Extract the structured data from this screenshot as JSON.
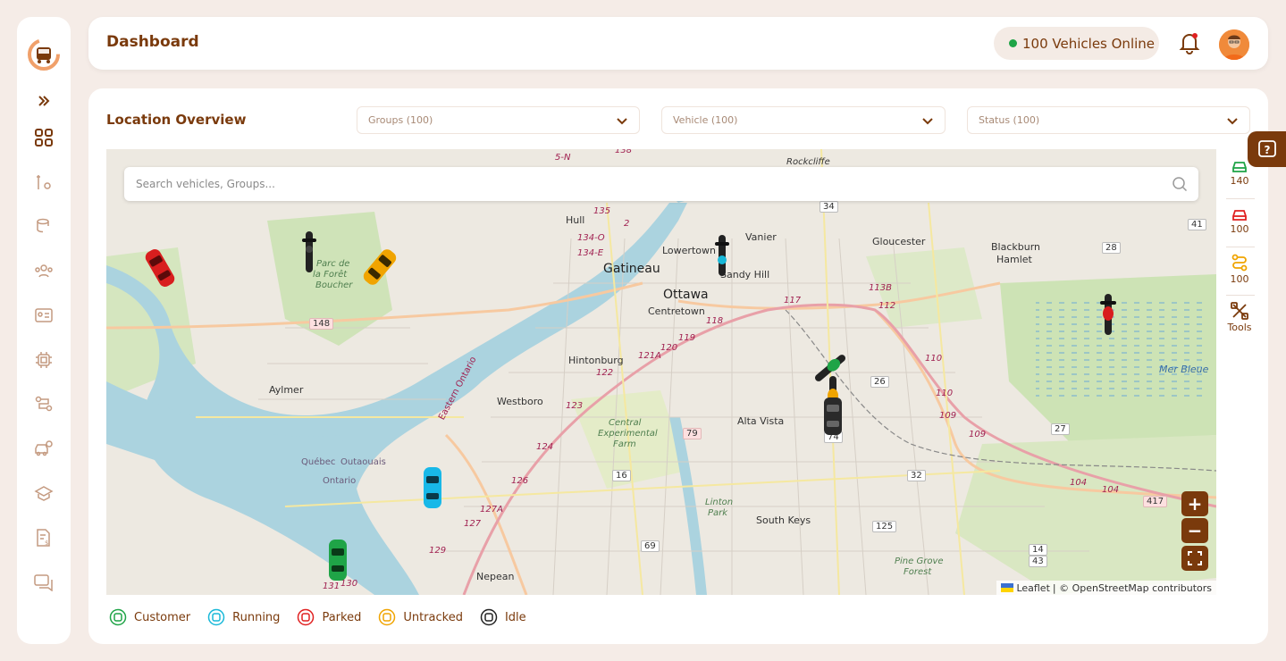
{
  "header": {
    "title": "Dashboard",
    "online_text": "100 Vehicles Online"
  },
  "panel": {
    "title": "Location Overview",
    "filters": [
      "Groups (100)",
      "Vehicle (100)",
      "Status (100)"
    ],
    "search_placeholder": "Search vehicles, Groups..."
  },
  "map": {
    "places": {
      "gatineau": "Gatineau",
      "ottawa": "Ottawa",
      "centretown": "Centretown",
      "hull": "Hull",
      "lowertown": "Lowertown",
      "sandy_hill": "Sandy Hill",
      "vanier": "Vanier",
      "gloucester": "Gloucester",
      "blackburn": "Blackburn",
      "hamlet": "Hamlet",
      "rockcliffe": "Rockcliffe",
      "aylmer": "Aylmer",
      "hintonburg": "Hintonburg",
      "westboro": "Westboro",
      "alta_vista": "Alta Vista",
      "south_keys": "South Keys",
      "nepean": "Nepean",
      "mer_bleue": "Mer Bleue",
      "parc1": "Parc de",
      "parc2": "la Forêt",
      "parc3": "Boucher",
      "cef1": "Central",
      "cef2": "Experimental",
      "cef3": "Farm",
      "linton1": "Linton",
      "linton2": "Park",
      "pine1": "Pine Grove",
      "pine2": "Forest",
      "quebec": "Québec",
      "outaouais": "Outaouais",
      "ontario": "Ontario",
      "eastern_ontario": "Eastern Ontario"
    },
    "shields": [
      "148",
      "34",
      "28",
      "41",
      "26",
      "27",
      "79",
      "16",
      "32",
      "417",
      "125",
      "69",
      "74",
      "14",
      "43"
    ],
    "routes": [
      "135",
      "134-O",
      "134-E",
      "117",
      "113B",
      "112",
      "110",
      "109",
      "104",
      "118",
      "119",
      "120",
      "121A",
      "122",
      "123",
      "124",
      "126",
      "127A",
      "127",
      "129",
      "131",
      "130",
      "138",
      "5-N",
      "2",
      "110",
      "109",
      "104"
    ],
    "zoom_in": "+",
    "zoom_out": "−",
    "attribution_leaflet": "Leaflet",
    "attribution_osm": "| © OpenStreetMap contributors"
  },
  "rightbar": [
    {
      "label": "140",
      "icon": "car-front-icon",
      "color": "#1fa447"
    },
    {
      "label": "100",
      "icon": "car-front-icon",
      "color": "#e02020"
    },
    {
      "label": "100",
      "icon": "route-icon",
      "color": "#f0a400"
    },
    {
      "label": "Tools",
      "icon": "tools-icon",
      "color": "#7a3a0c"
    }
  ],
  "legend": [
    {
      "label": "Customer",
      "color": "#1fa447"
    },
    {
      "label": "Running",
      "color": "#18b8d8"
    },
    {
      "label": "Parked",
      "color": "#e02020"
    },
    {
      "label": "Untracked",
      "color": "#f0a400"
    },
    {
      "label": "Idle",
      "color": "#222222"
    }
  ]
}
